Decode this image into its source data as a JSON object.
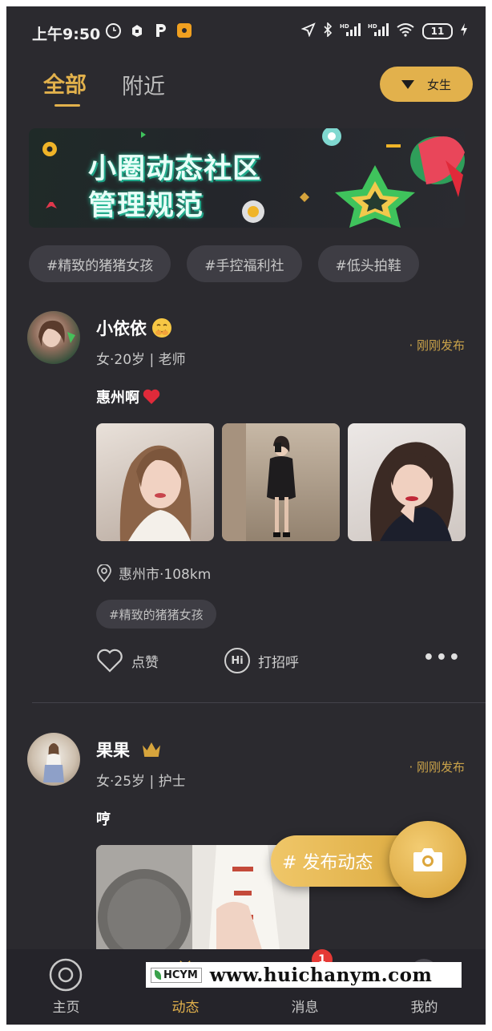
{
  "status_bar": {
    "time": "上午9:50",
    "battery": "11"
  },
  "top_tabs": {
    "all": "全部",
    "nearby": "附近",
    "gender_filter": "女生"
  },
  "banner": {
    "line1": "小圈动态社区",
    "line2": "管理规范"
  },
  "topic_chips": [
    "#精致的猪猪女孩",
    "#手控福利社",
    "#低头拍鞋"
  ],
  "posts": [
    {
      "name": "小依依",
      "meta": "女·20岁 | 老师",
      "posted": "· 刚刚发布",
      "text": "惠州啊",
      "location": "惠州市·108km",
      "tag": "#精致的猪猪女孩",
      "like_label": "点赞",
      "greet_label": "打招呼",
      "greet_icon": "Hi"
    },
    {
      "name": "果果",
      "meta": "女·25岁 | 护士",
      "posted": "· 刚刚发布",
      "text": "哼"
    }
  ],
  "publish_button": "# 发布动态",
  "bottom_nav": {
    "items": [
      {
        "label": "主页"
      },
      {
        "label": "动态"
      },
      {
        "label": "消息"
      },
      {
        "label": "我的"
      }
    ],
    "message_badge": "1"
  },
  "watermark": {
    "logo": "HCYM",
    "url": "www.huichanym.com"
  },
  "colors": {
    "accent": "#e2b14c",
    "background": "#2b2a2f",
    "badge": "#e53935"
  }
}
